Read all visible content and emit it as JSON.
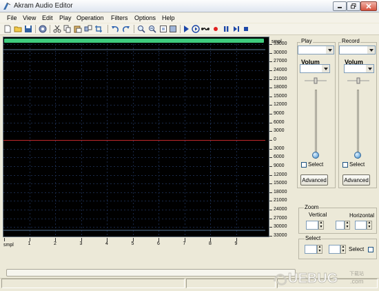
{
  "window": {
    "title": "Akram Audio Editor",
    "buttons": [
      "minimize",
      "restore",
      "close"
    ]
  },
  "menu": {
    "items": [
      "File",
      "View",
      "Edit",
      "Play",
      "Operation",
      "Filters",
      "Options",
      "Help"
    ]
  },
  "toolbar": {
    "icons": [
      "new-file-icon",
      "open-folder-icon",
      "save-icon",
      "record-settings-icon",
      "cut-icon",
      "copy-icon",
      "paste-icon",
      "mix-paste-icon",
      "undo-icon",
      "redo-icon",
      "zoom-in-icon",
      "zoom-out-icon",
      "zoom-selection-icon",
      "zoom-full-icon",
      "play-icon",
      "play-looped-icon",
      "loop-icon",
      "record-icon",
      "pause-icon",
      "play-to-end-icon",
      "stop-icon"
    ]
  },
  "waveform": {
    "progress_color": "#3fcc7e",
    "background": "#000000",
    "center_line_color": "#c0292b",
    "y_axis_unit": "smpl",
    "y_ticks": [
      "33000",
      "30000",
      "27000",
      "24000",
      "21000",
      "18000",
      "15000",
      "12000",
      "9000",
      "6000",
      "3000",
      "0",
      "3000",
      "6000",
      "9000",
      "12000",
      "15000",
      "18000",
      "21000",
      "24000",
      "27000",
      "30000",
      "33000"
    ],
    "x_axis_unit": "smpl",
    "x_ticks": [
      "1",
      "2",
      "3",
      "4",
      "5",
      "6",
      "7",
      "8",
      "9"
    ]
  },
  "play_panel": {
    "label": "Play",
    "volume_label": "Volum",
    "select_label": "Select",
    "advanced_label": "Advanced",
    "volume_level": 0.05
  },
  "record_panel": {
    "label": "Record",
    "volume_label": "Volum",
    "select_label": "Select",
    "advanced_label": "Advanced",
    "volume_level": 0.05
  },
  "zoom_panel": {
    "label": "Zoom",
    "vertical_label": "Vertical",
    "horizontal_label": "Horizontal"
  },
  "select_panel": {
    "label": "Select",
    "select_checkbox_label": "Select"
  },
  "watermark": {
    "brand": "UEBUG",
    "sub": "下载站",
    "domain": ".com"
  }
}
